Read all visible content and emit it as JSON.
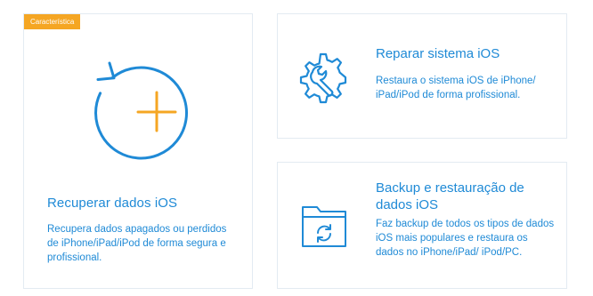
{
  "colors": {
    "accent": "#1f8ad6",
    "orange": "#f5a623",
    "border": "#e3ebf2"
  },
  "cards": {
    "recover": {
      "badge": "Característica",
      "title": "Recuperar dados iOS",
      "description": "Recupera dados apagados ou perdidos de iPhone/iPad/iPod de forma segura e profissional.",
      "icon": "circular-arrow-plus-icon"
    },
    "repair": {
      "title": "Reparar sistema iOS",
      "description": "Restaura o sistema iOS de iPhone/ iPad/iPod de forma profissional.",
      "icon": "gear-wrench-icon"
    },
    "backup": {
      "title": "Backup e restauração de dados iOS",
      "description": "Faz backup de todos os tipos de dados iOS mais populares e restaura os dados no iPhone/iPad/ iPod/PC.",
      "icon": "folder-sync-icon"
    }
  }
}
